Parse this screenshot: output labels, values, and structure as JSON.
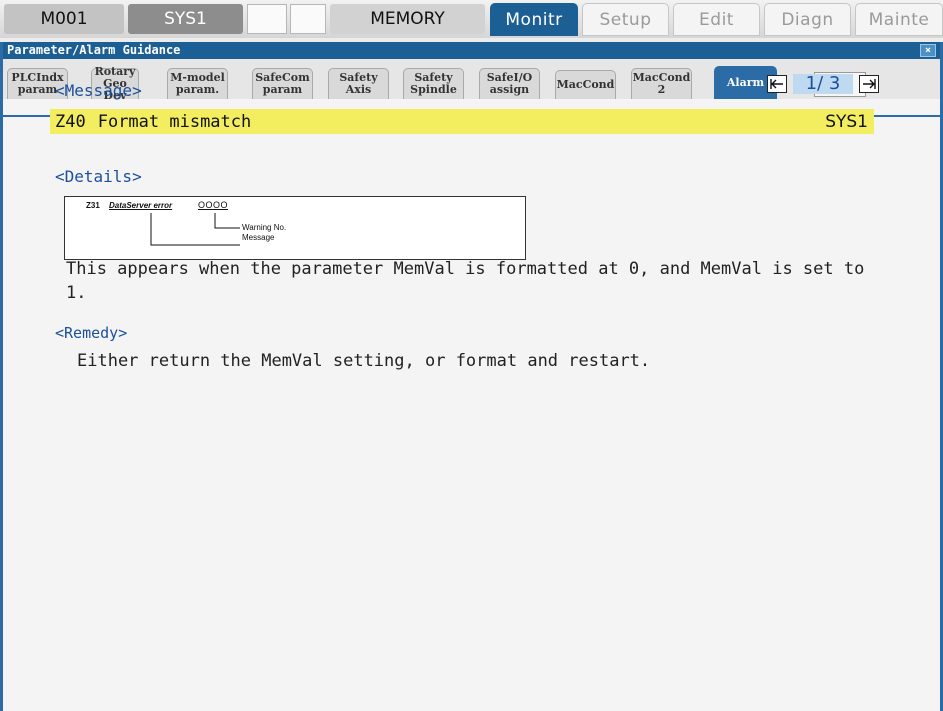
{
  "status_bar": {
    "program": "M001",
    "system": "SYS1",
    "mode": "MEMORY",
    "tabs": [
      {
        "label": "Monitr",
        "active": true
      },
      {
        "label": "Setup",
        "active": false
      },
      {
        "label": "Edit",
        "active": false
      },
      {
        "label": "Diagn",
        "active": false
      },
      {
        "label": "Mainte",
        "active": false
      }
    ]
  },
  "window": {
    "title": "Parameter/Alarm Guidance",
    "close_label": "×",
    "subtabs": [
      {
        "line1": "PLCIndx",
        "line2": "param"
      },
      {
        "line1": "Rotary",
        "line2": "Geo Dev"
      },
      {
        "line1": "M-model",
        "line2": "param."
      },
      {
        "line1": "SafeCom",
        "line2": "param"
      },
      {
        "line1": "Safety",
        "line2": "Axis"
      },
      {
        "line1": "Safety",
        "line2": "Spindle"
      },
      {
        "line1": "SafeI/O",
        "line2": "assign"
      },
      {
        "line1": "MacCond",
        "line2": ""
      },
      {
        "line1": "MacCond",
        "line2": "2"
      },
      {
        "line1": "Alarm",
        "line2": "",
        "active": true
      }
    ],
    "back_icon": "return-arrow-icon"
  },
  "content": {
    "message_header": "<Message>",
    "page_indicator": "1/ 3",
    "alarm": {
      "code": "Z40",
      "title": "Format mismatch",
      "system": "SYS1"
    },
    "details_header": "<Details>",
    "detail_figure": {
      "code": "Z31",
      "name": "DataServer error",
      "param": "OOOO",
      "warning_label": "Warning No.",
      "message_label": "Message"
    },
    "description": "This appears when the parameter MemVal is formatted at 0, and MemVal is set to 1.",
    "remedy_header": "<Remedy>",
    "remedy_text": "Either return the MemVal setting, or format and restart."
  },
  "colors": {
    "accent_blue": "#1c5f95",
    "highlight_yellow": "#f3ee60",
    "header_text_blue": "#1b4f9c"
  }
}
